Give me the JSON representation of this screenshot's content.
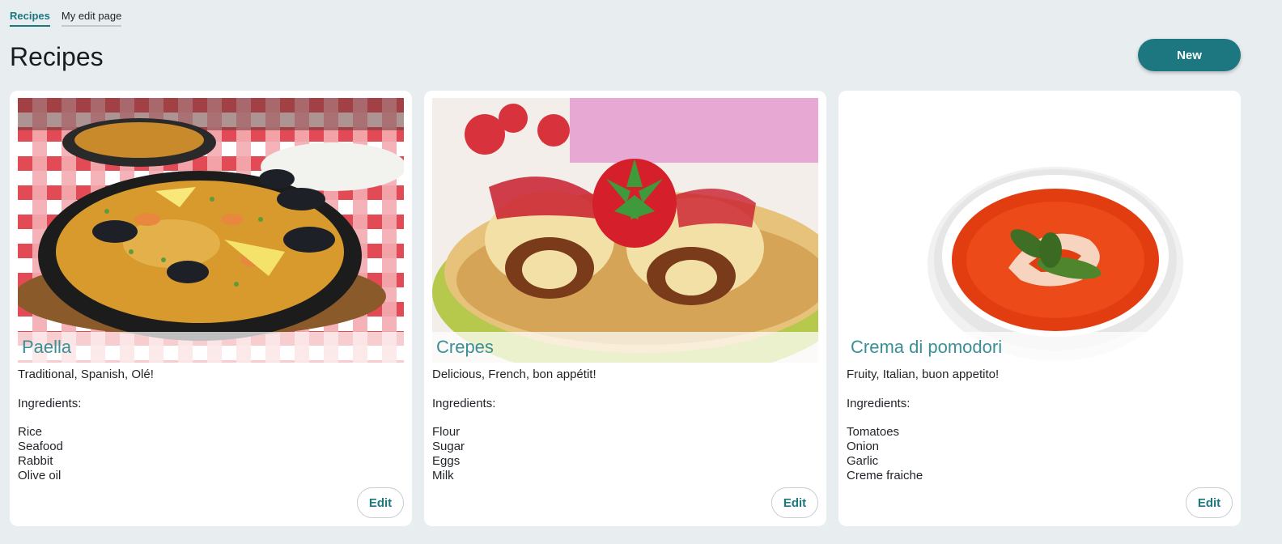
{
  "tabs": [
    {
      "label": "Recipes",
      "active": true
    },
    {
      "label": "My edit page",
      "active": false
    }
  ],
  "header": {
    "title": "Recipes",
    "new_label": "New"
  },
  "theme": {
    "accent": "#1c7780",
    "title_color": "#3a8f96",
    "background": "#e8edf0"
  },
  "recipes": [
    {
      "title": "Paella",
      "description": "Traditional, Spanish, Olé!",
      "ingredients_label": "Ingredients:",
      "ingredients": [
        "Rice",
        "Seafood",
        "Rabbit",
        "Olive oil"
      ],
      "edit_label": "Edit",
      "image": "paella-pan-photo"
    },
    {
      "title": "Crepes",
      "description": "Delicious, French, bon appétit!",
      "ingredients_label": "Ingredients:",
      "ingredients": [
        "Flour",
        "Sugar",
        "Eggs",
        "Milk"
      ],
      "edit_label": "Edit",
      "image": "rolled-crepes-strawberry-photo"
    },
    {
      "title": "Crema di pomodori",
      "description": "Fruity, Italian, buon appetito!",
      "ingredients_label": "Ingredients:",
      "ingredients": [
        "Tomatoes",
        "Onion",
        "Garlic",
        "Creme fraiche"
      ],
      "edit_label": "Edit",
      "image": "tomato-soup-bowl-photo"
    }
  ]
}
